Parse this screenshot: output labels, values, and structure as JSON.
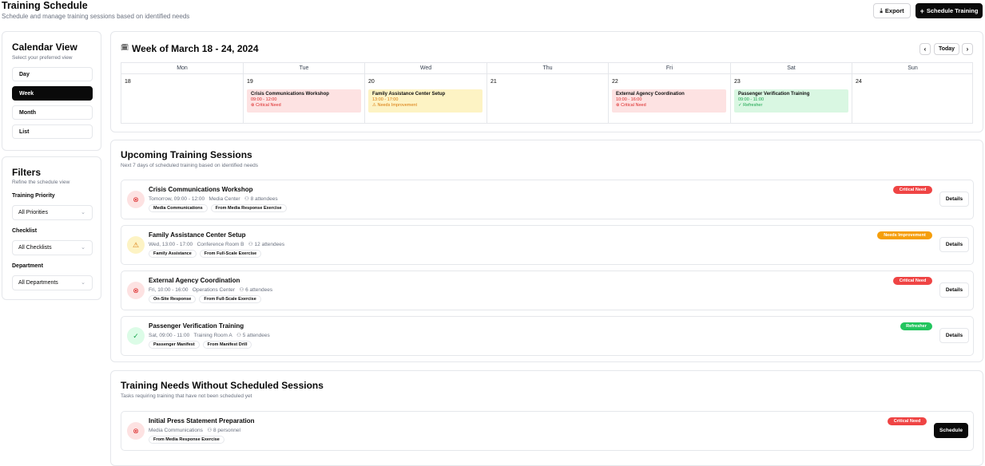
{
  "header": {
    "title": "Training Schedule",
    "subtitle": "Schedule and manage training sessions based on identified needs",
    "export_label": "Export",
    "schedule_label": "Schedule Training"
  },
  "calendar_view": {
    "title": "Calendar View",
    "subtitle": "Select your preferred view",
    "options": [
      "Day",
      "Week",
      "Month",
      "List"
    ],
    "active": "Week"
  },
  "filters": {
    "title": "Filters",
    "subtitle": "Refine the schedule view",
    "priority_label": "Training Priority",
    "priority_value": "All Priorities",
    "checklist_label": "Checklist",
    "checklist_value": "All Checklists",
    "department_label": "Department",
    "department_value": "All Departments"
  },
  "calendar": {
    "title": "Week of March 18 - 24, 2024",
    "today_label": "Today",
    "days": [
      {
        "name": "Mon",
        "date": "18"
      },
      {
        "name": "Tue",
        "date": "19"
      },
      {
        "name": "Wed",
        "date": "20"
      },
      {
        "name": "Thu",
        "date": "21"
      },
      {
        "name": "Fri",
        "date": "22"
      },
      {
        "name": "Sat",
        "date": "23"
      },
      {
        "name": "Sun",
        "date": "24"
      }
    ],
    "events": [
      {
        "title": "Crisis Communications Workshop",
        "time": "09:00 - 12:00",
        "tag": "Critical Need"
      },
      {
        "title": "Family Assistance Center Setup",
        "time": "13:00 - 17:00",
        "tag": "Needs Improvement"
      },
      {
        "title": "External Agency Coordination",
        "time": "10:00 - 16:00",
        "tag": "Critical Need"
      },
      {
        "title": "Passenger Verification Training",
        "time": "09:00 - 11:00",
        "tag": "Refresher"
      }
    ]
  },
  "upcoming": {
    "title": "Upcoming Training Sessions",
    "subtitle": "Next 7 days of scheduled training based on identified needs",
    "details_label": "Details",
    "sessions": [
      {
        "title": "Crisis Communications Workshop",
        "when": "Tomorrow, 09:00 - 12:00",
        "location": "Media Center",
        "attendees": "8 attendees",
        "tags": [
          "Media Communications",
          "From Media Response Exercise"
        ],
        "badge": "Critical Need"
      },
      {
        "title": "Family Assistance Center Setup",
        "when": "Wed, 13:00 - 17:00",
        "location": "Conference Room B",
        "attendees": "12 attendees",
        "tags": [
          "Family Assistance",
          "From Full-Scale Exercise"
        ],
        "badge": "Needs Improvement"
      },
      {
        "title": "External Agency Coordination",
        "when": "Fri, 10:00 - 16:00",
        "location": "Operations Center",
        "attendees": "6 attendees",
        "tags": [
          "On-Site Response",
          "From Full-Scale Exercise"
        ],
        "badge": "Critical Need"
      },
      {
        "title": "Passenger Verification Training",
        "when": "Sat, 09:00 - 11:00",
        "location": "Training Room A",
        "attendees": "5 attendees",
        "tags": [
          "Passenger Manifest",
          "From Manifest Drill"
        ],
        "badge": "Refresher"
      }
    ]
  },
  "unscheduled": {
    "title": "Training Needs Without Scheduled Sessions",
    "subtitle": "Tasks requiring training that have not been scheduled yet",
    "schedule_label": "Schedule",
    "items": [
      {
        "title": "Initial Press Statement Preparation",
        "department": "Media Communications",
        "personnel": "8 personnel",
        "tags": [
          "From Media Response Exercise"
        ],
        "badge": "Critical Need"
      }
    ]
  },
  "colors": {
    "critical": "#ef4444",
    "improvement": "#f59e0b",
    "refresher": "#22c55e",
    "primary": "#0a0a0a"
  }
}
